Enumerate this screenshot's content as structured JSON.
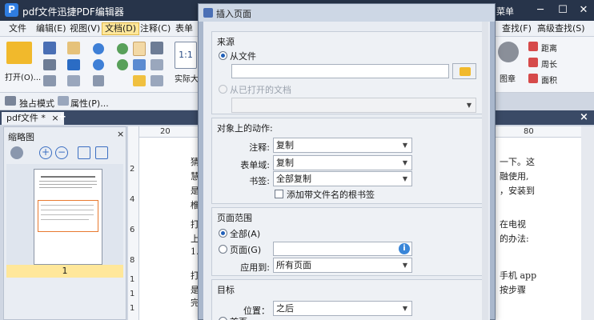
{
  "app": {
    "title": "pdf文件迅捷PDF编辑器",
    "menu_label": "菜单",
    "logo_letter": "P",
    "minimize_glyph": "─",
    "maximize_glyph": "☐",
    "close_glyph": "✕"
  },
  "menubar": {
    "items": [
      "文件",
      "编辑(E)",
      "视图(V)",
      "文档(D)",
      "注释(C)",
      "表单"
    ],
    "active_index": 3,
    "right_items": [
      "查找(F)",
      "高级查找(S)"
    ]
  },
  "ribbon": {
    "open_label": "打开(O)...",
    "actual_size_label": "实际大",
    "actual_size_glyph": "1:1",
    "page_label": "图章",
    "right_tools": [
      "距离",
      "周长",
      "面积"
    ]
  },
  "subtoolbar": {
    "exclusive_mode": "独占模式",
    "properties": "属性(P)..."
  },
  "tabs": {
    "doc_tab": "pdf文件 *",
    "close_glyph": "×",
    "add_glyph": "+"
  },
  "thumbnails": {
    "title": "缩略图",
    "close_glyph": "×",
    "page_number": "1"
  },
  "rulers": {
    "h_ticks": [
      "20",
      "80"
    ],
    "v_ticks": [
      "2",
      "4",
      "6",
      "8",
      "1",
      "1",
      "1",
      "1"
    ]
  },
  "document": {
    "lines_right": [
      "一下。这",
      "融使用,",
      "，安装到",
      "在电视",
      "的办法:",
      "手机 app",
      "按步骤"
    ],
    "lines_left": [
      "猜",
      "慧",
      "是",
      "椎",
      "打",
      "上",
      "1.",
      "打",
      "是",
      "完"
    ]
  },
  "dialog": {
    "title": "插入页面",
    "source": {
      "title": "来源",
      "from_file": "从文件",
      "from_opened": "从已打开的文档",
      "from_file_selected": true
    },
    "action": {
      "title": "对象上的动作:",
      "annotations_label": "注释:",
      "annotations_value": "复制",
      "form_fields_label": "表单域:",
      "form_fields_value": "复制",
      "bookmarks_label": "书签:",
      "bookmarks_value": "全部复制",
      "add_bookmark_label": "添加带文件名的根书签",
      "add_bookmark_checked": false
    },
    "range": {
      "title": "页面范围",
      "all_label": "全部(A)",
      "pages_label": "页面(G)",
      "apply_to_label": "应用到:",
      "apply_to_value": "所有页面",
      "all_selected": true
    },
    "target": {
      "title": "目标",
      "position_label": "位置：",
      "position_value": "之后",
      "first_page_label": "首页"
    }
  },
  "colors": {
    "titlebar": "#27344a",
    "accent": "#2f7de1",
    "active_menu": "#ffe79a"
  }
}
